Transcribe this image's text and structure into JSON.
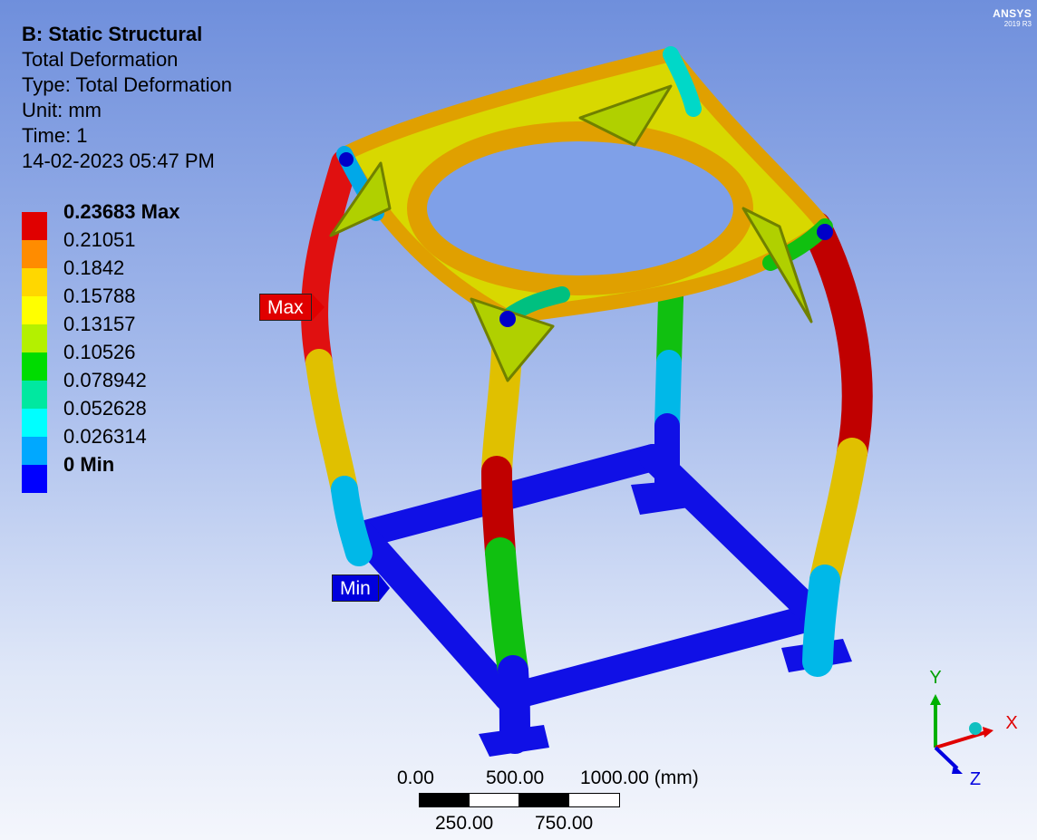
{
  "brand": {
    "name": "ANSYS",
    "version": "2019 R3"
  },
  "header": {
    "title": "B: Static Structural",
    "result": "Total Deformation",
    "type": "Type: Total Deformation",
    "unit": "Unit: mm",
    "time": "Time: 1",
    "date": "14-02-2023 05:47 PM"
  },
  "legend": {
    "labels": [
      "0.23683 Max",
      "0.21051",
      "0.1842",
      "0.15788",
      "0.13157",
      "0.10526",
      "0.078942",
      "0.052628",
      "0.026314",
      "0 Min"
    ],
    "colors": [
      "#e00000",
      "#ff8c00",
      "#ffd700",
      "#ffff00",
      "#b4f000",
      "#00dc00",
      "#00e8a0",
      "#00ffff",
      "#00a8ff",
      "#0000ff"
    ]
  },
  "markers": {
    "max": "Max",
    "min": "Min"
  },
  "scale": {
    "top_ticks": [
      "0.00",
      "500.00",
      "1000.00 (mm)"
    ],
    "bottom_ticks": [
      "250.00",
      "750.00"
    ]
  },
  "triad": {
    "x": "X",
    "y": "Y",
    "z": "Z"
  }
}
